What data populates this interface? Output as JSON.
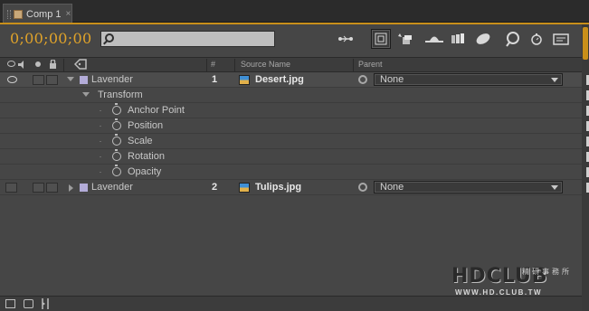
{
  "tab": {
    "title": "Comp 1",
    "close": "×"
  },
  "header": {
    "timecode": "0;00;00;00",
    "search_value": ""
  },
  "toolbar": {
    "icons": [
      "mini-flowchart-icon",
      "draft-3d-icon",
      "shy-icon",
      "frame-blending-icon",
      "motion-blur-icon",
      "brainstorm-icon",
      "auto-keyframe-icon",
      "graph-editor-icon",
      "comp-flowchart-icon"
    ]
  },
  "columns": {
    "num": "#",
    "source": "Source Name",
    "parent": "Parent"
  },
  "layers": [
    {
      "layer_name": "Lavender",
      "num": "1",
      "source": "Desert.jpg",
      "parent": "None"
    },
    {
      "layer_name": "Lavender",
      "num": "2",
      "source": "Tulips.jpg",
      "parent": "None"
    }
  ],
  "transform": {
    "label": "Transform",
    "properties": [
      "Anchor Point",
      "Position",
      "Scale",
      "Rotation",
      "Opacity"
    ]
  },
  "watermark": {
    "logo": "HDCLUB",
    "chinese": "精研事務所",
    "url": "WWW.HD.CLUB.TW"
  },
  "colors": {
    "accent": "#c98f1a",
    "timecode": "#e0a32a",
    "label_swatch": "#b3acd8"
  }
}
